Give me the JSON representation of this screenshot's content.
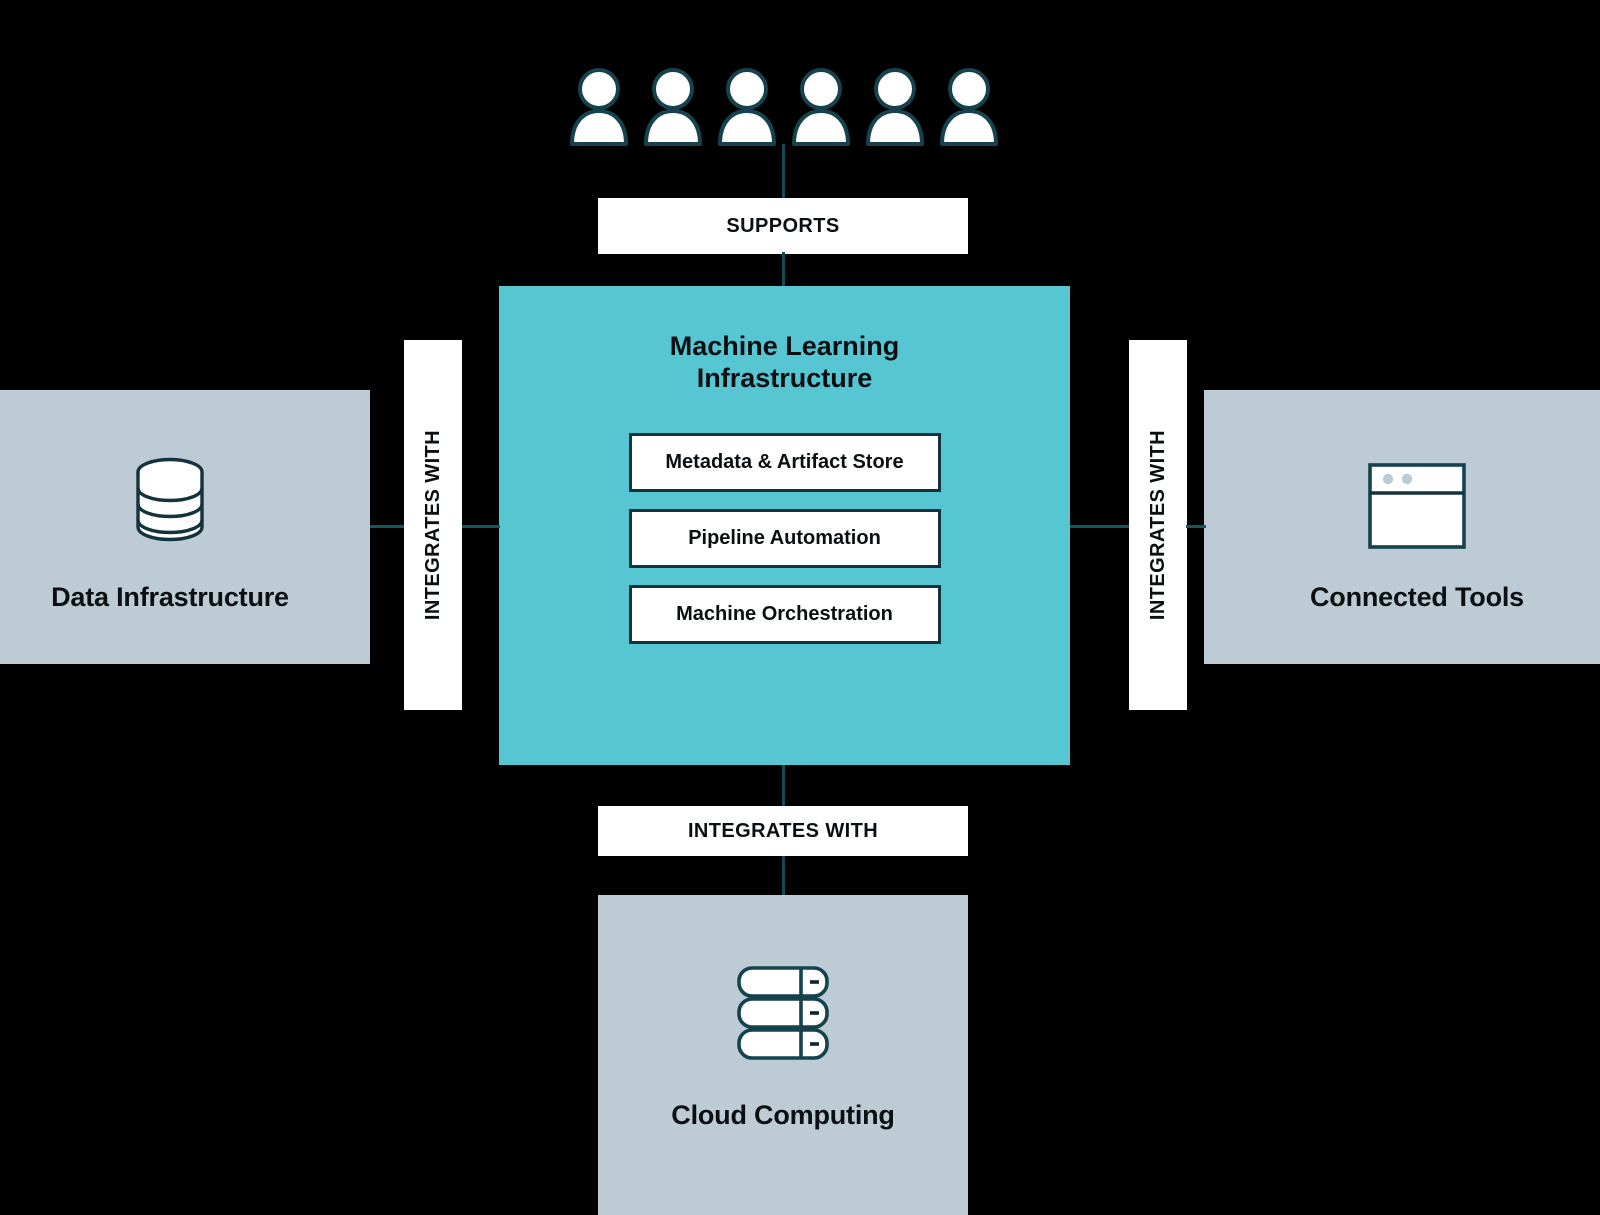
{
  "diagram": {
    "title": "Machine Learning Infrastructure ecosystem diagram",
    "colors": {
      "hub_fill": "#56c6d3",
      "panel_fill": "#bdccd4",
      "stroke": "#15333c",
      "connector": "#15565f",
      "background": "#000000",
      "label_fill": "#ffffff",
      "text": "#0b0f12"
    }
  },
  "people": {
    "icon": "person-icon",
    "count": 6
  },
  "connectors": {
    "supports": "SUPPORTS",
    "integrates_left": "INTEGRATES WITH",
    "integrates_right": "INTEGRATES WITH",
    "integrates_bottom": "INTEGRATES WITH"
  },
  "hub": {
    "title": "Machine Learning\nInfrastructure",
    "items": [
      {
        "label": "Metadata & Artifact Store"
      },
      {
        "label": "Pipeline Automation"
      },
      {
        "label": "Machine Orchestration"
      }
    ]
  },
  "panels": {
    "left": {
      "label": "Data Infrastructure",
      "icon": "database-icon"
    },
    "right": {
      "label": "Connected Tools",
      "icon": "browser-window-icon"
    },
    "bottom": {
      "label": "Cloud Computing",
      "icon": "server-stack-icon"
    }
  }
}
